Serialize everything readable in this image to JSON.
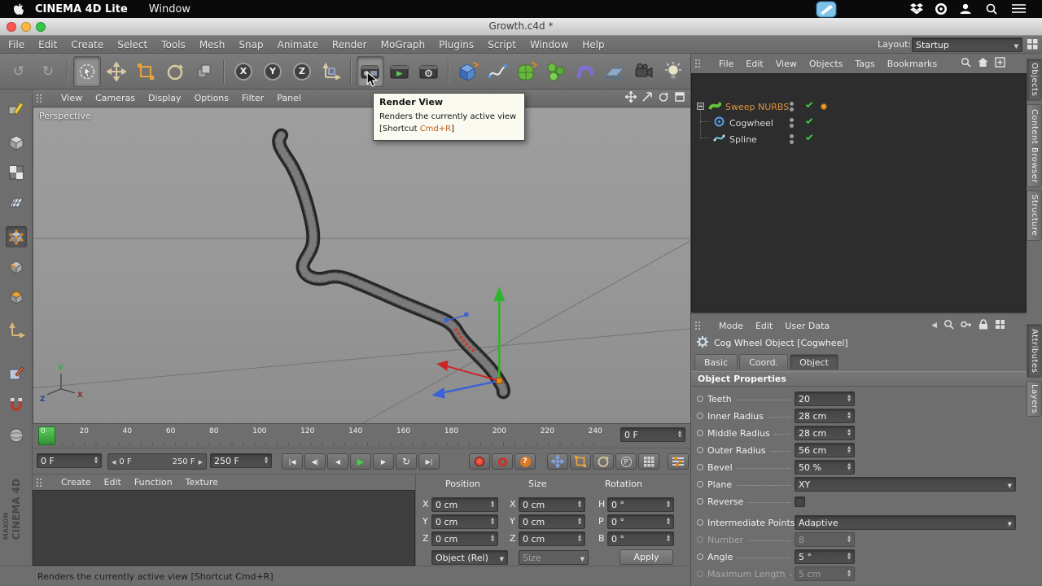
{
  "macos_menubar": {
    "app_name": "CINEMA 4D Lite",
    "window_menu": "Window"
  },
  "titlebar": {
    "title": "Growth.c4d *"
  },
  "menubar": {
    "items": [
      "File",
      "Edit",
      "Create",
      "Select",
      "Tools",
      "Mesh",
      "Snap",
      "Animate",
      "Render",
      "MoGraph",
      "Plugins",
      "Script",
      "Window",
      "Help"
    ],
    "layout_label": "Layout:",
    "layout_value": "Startup"
  },
  "icons": {
    "undo": "↺",
    "redo": "↻",
    "axis_x": "X",
    "axis_y": "Y",
    "axis_z": "Z",
    "goto_start": "|◀",
    "prev_key": "◀|",
    "prev_frame": "◀",
    "play": "▶",
    "next_frame": "▶",
    "loop": "↻",
    "goto_end": "▶|",
    "question": "?",
    "parameter": "P"
  },
  "tooltip": {
    "title": "Render View",
    "description": "Renders the currently active view",
    "shortcut_prefix": "[Shortcut ",
    "shortcut_key": "Cmd+R",
    "shortcut_suffix": "]"
  },
  "viewport": {
    "menu": [
      "View",
      "Cameras",
      "Display",
      "Options",
      "Filter",
      "Panel"
    ],
    "camera_label": "Perspective"
  },
  "timeline": {
    "ticks": [
      "0",
      "20",
      "40",
      "60",
      "80",
      "100",
      "120",
      "140",
      "160",
      "180",
      "200",
      "220",
      "240"
    ],
    "current_frame": "0 F"
  },
  "transport": {
    "frame_field": "0 F",
    "range_start": "0 F",
    "range_end": "250 F",
    "end_field": "250 F"
  },
  "material_manager": {
    "menu": [
      "Create",
      "Edit",
      "Function",
      "Texture"
    ]
  },
  "coordinates": {
    "headers": [
      "Position",
      "Size",
      "Rotation"
    ],
    "pos_labels": [
      "X",
      "Y",
      "Z"
    ],
    "rot_labels": [
      "H",
      "P",
      "B"
    ],
    "pos_values": [
      "0 cm",
      "0 cm",
      "0 cm"
    ],
    "size_values": [
      "0 cm",
      "0 cm",
      "0 cm"
    ],
    "rot_values": [
      "0 °",
      "0 °",
      "0 °"
    ],
    "object_mode": "Object (Rel)",
    "size_mode": "Size",
    "apply_label": "Apply"
  },
  "object_manager": {
    "menu": [
      "File",
      "Edit",
      "View",
      "Objects",
      "Tags",
      "Bookmarks"
    ],
    "objects": [
      {
        "name": "Sweep NURBS"
      },
      {
        "name": "Cogwheel"
      },
      {
        "name": "Spline"
      }
    ],
    "side_tabs": [
      "Objects",
      "Content Browser",
      "Structure"
    ]
  },
  "attributes": {
    "menu": [
      "Mode",
      "Edit",
      "User Data"
    ],
    "object_title": "Cog Wheel Object [Cogwheel]",
    "tabs": [
      "Basic",
      "Coord.",
      "Object"
    ],
    "section": "Object Properties",
    "rows": [
      {
        "label": "Teeth",
        "value": "20"
      },
      {
        "label": "Inner Radius",
        "value": "28 cm"
      },
      {
        "label": "Middle Radius",
        "value": "28 cm"
      },
      {
        "label": "Outer Radius",
        "value": "56 cm"
      },
      {
        "label": "Bevel",
        "value": "50 %"
      },
      {
        "label": "Plane",
        "value": "XY"
      },
      {
        "label": "Reverse",
        "value": ""
      },
      {
        "label": "Intermediate Points",
        "value": "Adaptive"
      },
      {
        "label": "Number",
        "value": "8"
      },
      {
        "label": "Angle",
        "value": "5 °"
      },
      {
        "label": "Maximum Length",
        "value": "5 cm"
      }
    ],
    "side_tabs": [
      "Attributes",
      "Layers"
    ]
  },
  "status_bar": {
    "text": "Renders the currently active view [Shortcut Cmd+R]"
  },
  "branding": {
    "maxon": "MAXON",
    "cinema": "CINEMA 4D"
  }
}
